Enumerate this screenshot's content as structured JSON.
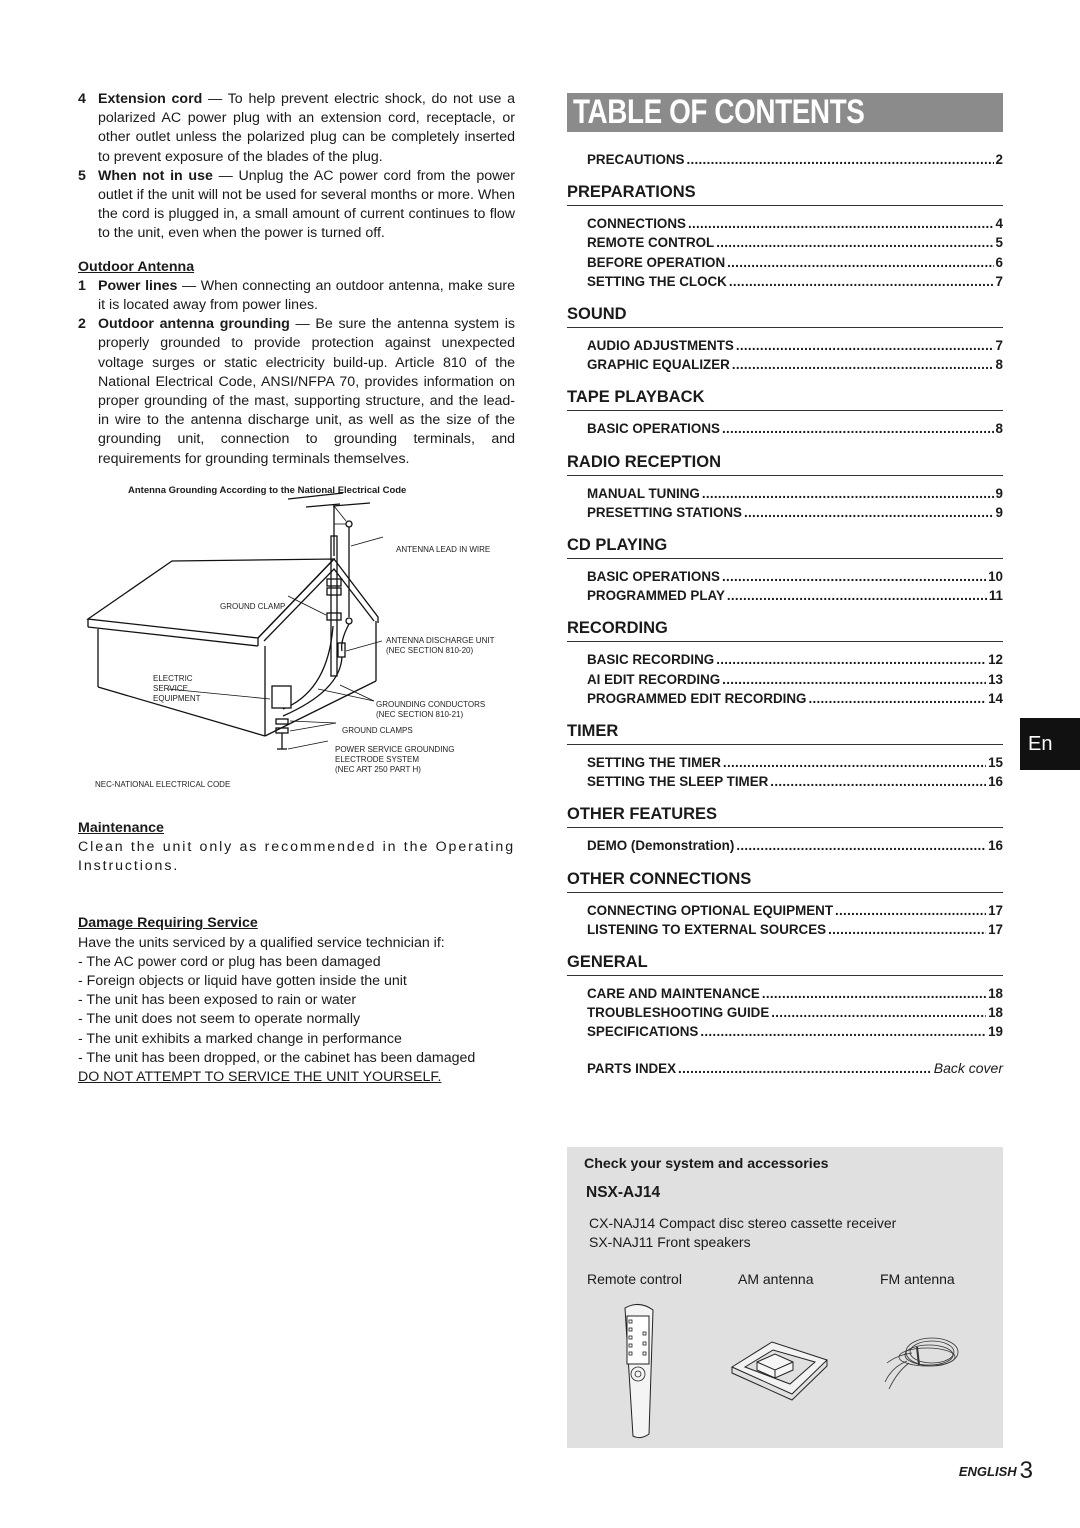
{
  "left": {
    "items_top": [
      {
        "n": "4",
        "bold": "Extension cord",
        "text": " — To help prevent electric shock, do not use a polarized AC power plug with an extension cord, receptacle, or other outlet unless the polarized plug can be completely inserted to prevent exposure of the blades of the plug."
      },
      {
        "n": "5",
        "bold": "When not in use",
        "text": " — Unplug the AC power cord from the power outlet if the unit will not be used for several months or more. When the cord is plugged in, a small amount of current continues to flow to the unit, even when the power is turned off."
      }
    ],
    "outdoor_antenna": {
      "heading": "Outdoor Antenna",
      "items": [
        {
          "n": "1",
          "bold": "Power lines",
          "text": " — When connecting an outdoor antenna, make sure it is located away from power lines."
        },
        {
          "n": "2",
          "bold": "Outdoor antenna grounding",
          "text": " — Be sure the antenna system is properly grounded to provide protection against unexpected voltage surges or static electricity build-up. Article 810 of the National Electrical Code, ANSI/NFPA 70, provides information on proper grounding of the mast, supporting structure, and the lead-in wire to the antenna discharge unit, as well as the size of the grounding unit, connection to grounding terminals, and requirements for grounding terminals themselves."
        }
      ]
    },
    "diagram": {
      "caption": "Antenna Grounding According to the National Electrical Code",
      "labels": {
        "lead_in": "ANTENNA LEAD IN WIRE",
        "ground_clamp": "GROUND CLAMP",
        "discharge_1": "ANTENNA DISCHARGE UNIT",
        "discharge_2": "(NEC SECTION 810-20)",
        "electric_1": "ELECTRIC",
        "electric_2": "SERVICE",
        "electric_3": "EQUIPMENT",
        "conductors_1": "GROUNDING CONDUCTORS",
        "conductors_2": "(NEC SECTION 810-21)",
        "ground_clamps": "GROUND CLAMPS",
        "power_1": "POWER SERVICE GROUNDING",
        "power_2": "ELECTRODE SYSTEM",
        "power_3": "(NEC ART 250 PART H)",
        "nec": "NEC-NATIONAL ELECTRICAL CODE"
      }
    },
    "maintenance": {
      "heading": "Maintenance",
      "text": "Clean the unit only as recommended in the Operating Instructions."
    },
    "damage": {
      "heading": "Damage Requiring Service",
      "intro": "Have the units serviced by a qualified service technician if:",
      "items": [
        "- The AC power cord or plug has been damaged",
        "- Foreign objects or liquid have gotten inside the unit",
        "- The unit has been exposed to rain or water",
        "- The unit does not seem to operate normally",
        "- The unit exhibits a marked change in performance",
        "- The unit has been dropped, or the cabinet has been damaged"
      ],
      "warning": "DO NOT ATTEMPT TO SERVICE THE UNIT YOURSELF."
    }
  },
  "toc": {
    "title": "TABLE OF CONTENTS",
    "precautions": {
      "title": "PRECAUTIONS",
      "page": "2"
    },
    "sections": [
      {
        "heading": "PREPARATIONS",
        "entries": [
          {
            "title": "CONNECTIONS",
            "page": "4"
          },
          {
            "title": "REMOTE CONTROL",
            "page": "5"
          },
          {
            "title": "BEFORE OPERATION",
            "page": "6"
          },
          {
            "title": "SETTING THE CLOCK",
            "page": "7"
          }
        ]
      },
      {
        "heading": "SOUND",
        "entries": [
          {
            "title": "AUDIO ADJUSTMENTS",
            "page": "7"
          },
          {
            "title": "GRAPHIC EQUALIZER",
            "page": "8"
          }
        ]
      },
      {
        "heading": "TAPE PLAYBACK",
        "entries": [
          {
            "title": "BASIC OPERATIONS",
            "page": "8"
          }
        ]
      },
      {
        "heading": "RADIO RECEPTION",
        "entries": [
          {
            "title": "MANUAL TUNING",
            "page": "9"
          },
          {
            "title": "PRESETTING STATIONS",
            "page": "9"
          }
        ]
      },
      {
        "heading": "CD PLAYING",
        "entries": [
          {
            "title": "BASIC OPERATIONS",
            "page": "10"
          },
          {
            "title": "PROGRAMMED PLAY",
            "page": "11"
          }
        ]
      },
      {
        "heading": "RECORDING",
        "entries": [
          {
            "title": "BASIC RECORDING",
            "page": "12"
          },
          {
            "title": "AI EDIT RECORDING",
            "page": "13"
          },
          {
            "title": "PROGRAMMED EDIT RECORDING",
            "page": "14"
          }
        ]
      },
      {
        "heading": "TIMER",
        "entries": [
          {
            "title": "SETTING THE TIMER",
            "page": "15"
          },
          {
            "title": "SETTING THE SLEEP TIMER",
            "page": "16"
          }
        ]
      },
      {
        "heading": "OTHER FEATURES",
        "entries": [
          {
            "title": "DEMO (Demonstration)",
            "page": "16"
          }
        ]
      },
      {
        "heading": "OTHER CONNECTIONS",
        "entries": [
          {
            "title": "CONNECTING OPTIONAL EQUIPMENT",
            "page": "17"
          },
          {
            "title": "LISTENING TO EXTERNAL SOURCES",
            "page": "17"
          }
        ]
      },
      {
        "heading": "GENERAL",
        "entries": [
          {
            "title": "CARE AND MAINTENANCE",
            "page": "18"
          },
          {
            "title": "TROUBLESHOOTING GUIDE",
            "page": "18"
          },
          {
            "title": "SPECIFICATIONS",
            "page": "19"
          }
        ]
      }
    ],
    "parts_index": {
      "title": "PARTS INDEX",
      "page": "Back cover"
    }
  },
  "accessories": {
    "heading": "Check your system and accessories",
    "model": "NSX-AJ14",
    "components": [
      "CX-NAJ14 Compact disc stereo cassette receiver",
      "SX-NAJ11 Front speakers"
    ],
    "items": [
      "Remote control",
      "AM antenna",
      "FM antenna"
    ]
  },
  "lang_tab": "En",
  "footer": {
    "language": "ENGLISH",
    "page": "3"
  },
  "colors": {
    "title_band": "#8b8b8b",
    "accessory_box": "#e0e0e0",
    "lang_tab": "#111111"
  }
}
